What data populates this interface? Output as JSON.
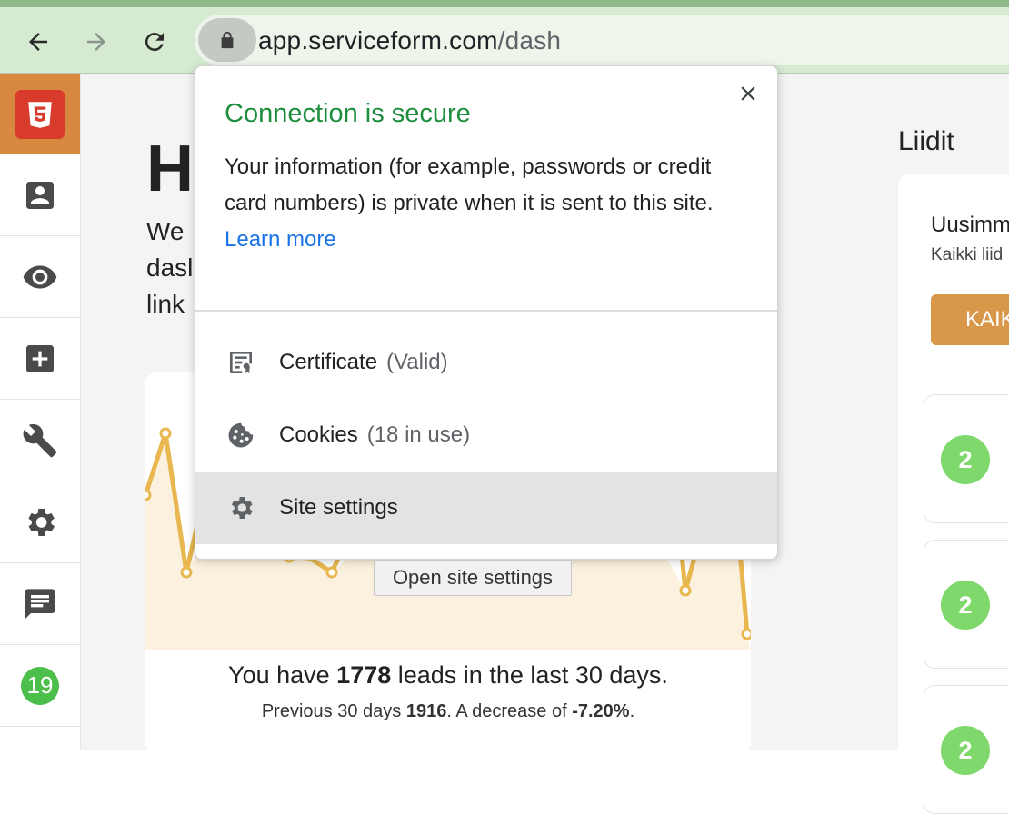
{
  "browser": {
    "url_host": "app.serviceform.com",
    "url_path": "/dash"
  },
  "popup": {
    "title": "Connection is secure",
    "description": "Your information (for example, passwords or credit card numbers) is private when it is sent to this site.",
    "learn_more": "Learn more",
    "items": [
      {
        "label": "Certificate",
        "detail": "(Valid)",
        "icon": "certificate-icon"
      },
      {
        "label": "Cookies",
        "detail": "(18 in use)",
        "icon": "cookie-icon"
      },
      {
        "label": "Site settings",
        "detail": "",
        "icon": "gear-icon"
      }
    ],
    "tooltip": "Open site settings"
  },
  "sidebar": {
    "icons": [
      "logo",
      "contact-icon",
      "eye-icon",
      "add-icon",
      "wrench-icon",
      "gear-icon",
      "chat-icon"
    ],
    "badge": "19"
  },
  "main": {
    "heading": "H",
    "intro_lines": [
      "We",
      "dasl",
      "link"
    ],
    "leads_prefix": "You have ",
    "leads_count": "1778",
    "leads_suffix": " leads in the last 30 days.",
    "prev_prefix": "Previous 30 days ",
    "prev_count": "1916",
    "prev_middle": ". A decrease of ",
    "prev_change": "-7.20%",
    "prev_end": "."
  },
  "liidit": {
    "title": "Liidit",
    "heading": "Uusimm",
    "subtext": "Kaikki liid",
    "button": "KAIK",
    "rows": [
      "2",
      "2",
      "2"
    ]
  },
  "colors": {
    "secure_green": "#1e8e3e",
    "link_blue": "#1a73e8",
    "accent_orange": "#d9974a",
    "chart_line": "#e8b74f"
  }
}
